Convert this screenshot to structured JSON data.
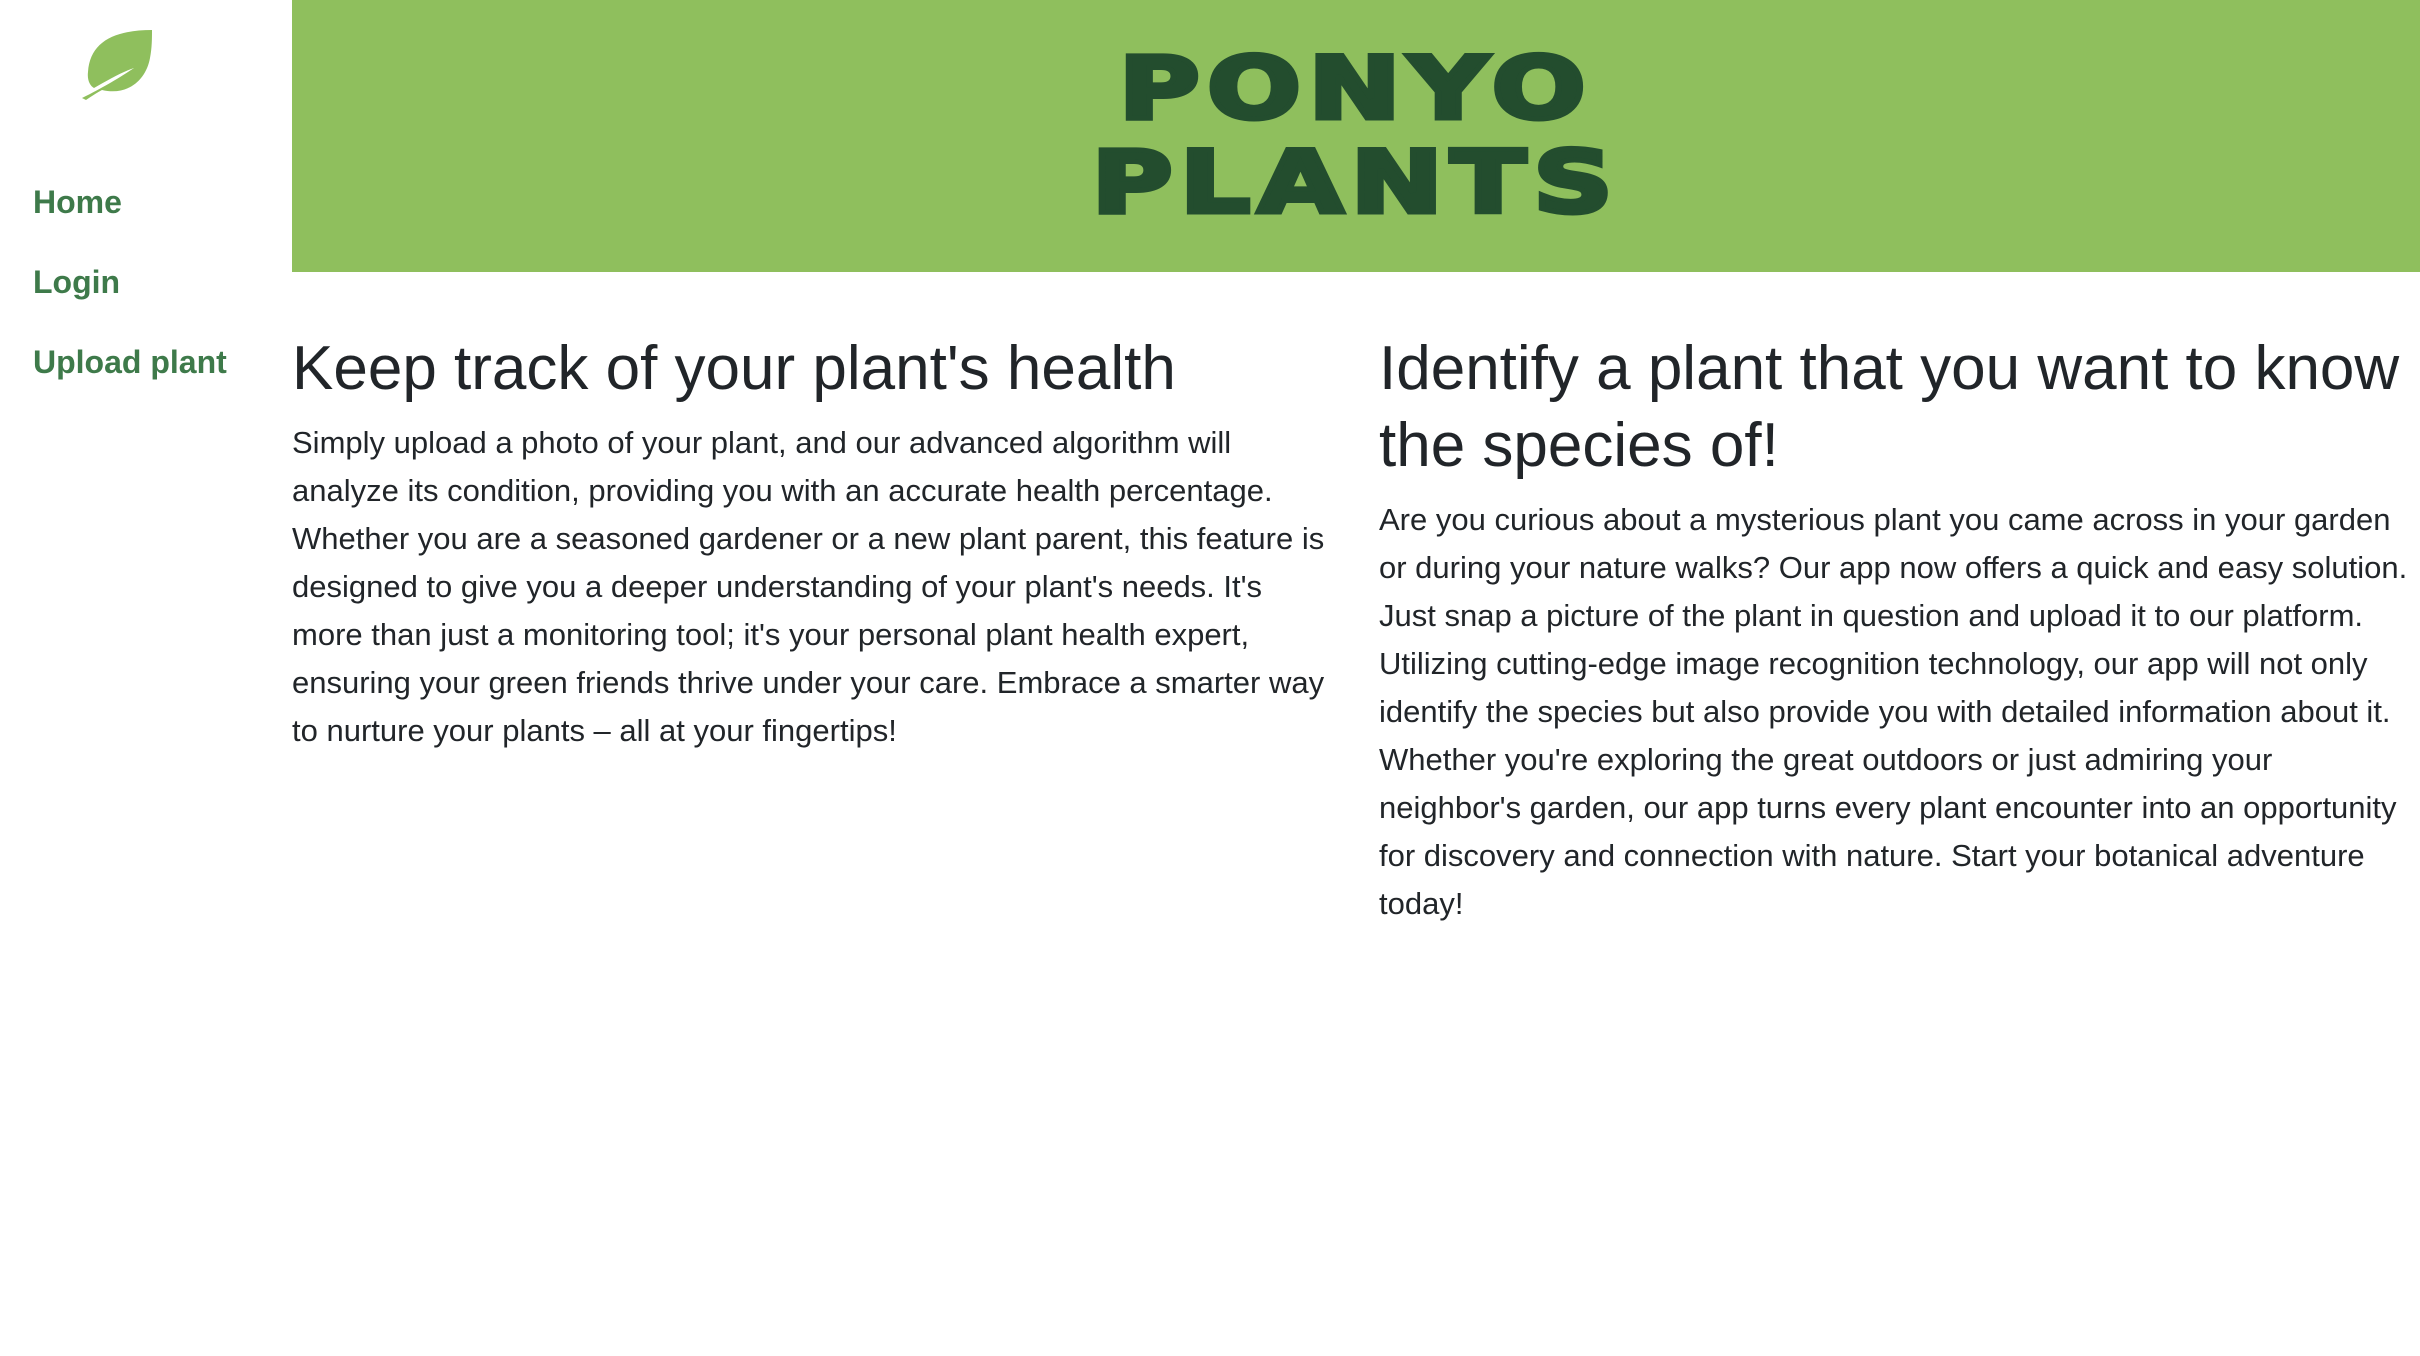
{
  "sidebar": {
    "logo_icon": "leaf-icon",
    "nav": {
      "home": "Home",
      "login": "Login",
      "upload": "Upload plant"
    }
  },
  "banner": {
    "title_line1": "PONYO",
    "title_line2": "PLANTS",
    "background": "#8fbf5d",
    "text_color": "#234d2e"
  },
  "features": {
    "health": {
      "heading": "Keep track of your plant's health",
      "body": "Simply upload a photo of your plant, and our advanced algorithm will analyze its condition, providing you with an accurate health percentage. Whether you are a seasoned gardener or a new plant parent, this feature is designed to give you a deeper understanding of your plant's needs. It's more than just a monitoring tool; it's your personal plant health expert, ensuring your green friends thrive under your care. Embrace a smarter way to nurture your plants – all at your fingertips!"
    },
    "identify": {
      "heading": "Identify a plant that you want to know the species of!",
      "body": "Are you curious about a mysterious plant you came across in your garden or during your nature walks? Our app now offers a quick and easy solution. Just snap a picture of the plant in question and upload it to our platform. Utilizing cutting-edge image recognition technology, our app will not only identify the species but also provide you with detailed information about it. Whether you're exploring the great outdoors or just admiring your neighbor's garden, our app turns every plant encounter into an opportunity for discovery and connection with nature. Start your botanical adventure today!"
    }
  },
  "colors": {
    "accent": "#8fbf5d",
    "nav_link": "#3e7a4a",
    "text": "#212529"
  }
}
